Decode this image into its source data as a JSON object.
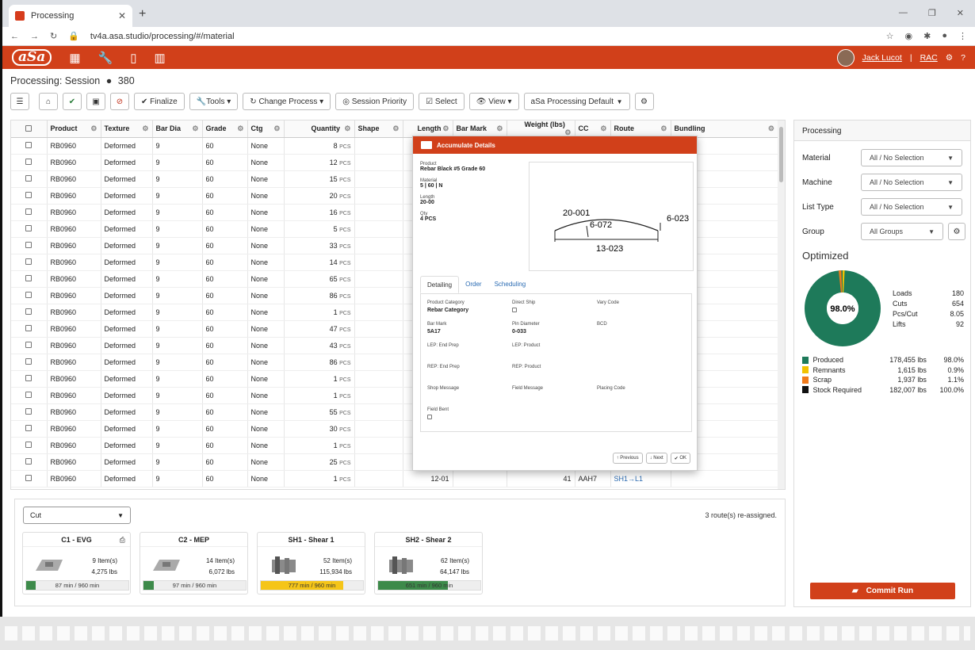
{
  "browser": {
    "tab_title": "Processing",
    "url": "tv4a.asa.studio/processing/#/material"
  },
  "app": {
    "logo": "aSa",
    "user": "Jack Lucot",
    "org": "RAC"
  },
  "page": {
    "title": "Processing: Session",
    "bullet": "●",
    "session": "380"
  },
  "toolbar": {
    "finalize": "Finalize",
    "tools": "Tools",
    "change_process": "Change Process",
    "session_priority": "Session Priority",
    "select": "Select",
    "view": "View",
    "profile": "aSa Processing Default"
  },
  "grid": {
    "columns": [
      "Product",
      "Texture",
      "Bar Dia",
      "Grade",
      "Ctg",
      "Quantity",
      "Shape",
      "Length",
      "Bar Mark",
      "Weight (lbs)",
      "CC",
      "Route",
      "Bundling"
    ],
    "unit": "PCS",
    "rows": [
      {
        "product": "RB0960",
        "texture": "Deformed",
        "dia": "9",
        "grade": "60",
        "ctg": "None",
        "qty": "8"
      },
      {
        "product": "RB0960",
        "texture": "Deformed",
        "dia": "9",
        "grade": "60",
        "ctg": "None",
        "qty": "12"
      },
      {
        "product": "RB0960",
        "texture": "Deformed",
        "dia": "9",
        "grade": "60",
        "ctg": "None",
        "qty": "15"
      },
      {
        "product": "RB0960",
        "texture": "Deformed",
        "dia": "9",
        "grade": "60",
        "ctg": "None",
        "qty": "20"
      },
      {
        "product": "RB0960",
        "texture": "Deformed",
        "dia": "9",
        "grade": "60",
        "ctg": "None",
        "qty": "16"
      },
      {
        "product": "RB0960",
        "texture": "Deformed",
        "dia": "9",
        "grade": "60",
        "ctg": "None",
        "qty": "5"
      },
      {
        "product": "RB0960",
        "texture": "Deformed",
        "dia": "9",
        "grade": "60",
        "ctg": "None",
        "qty": "33"
      },
      {
        "product": "RB0960",
        "texture": "Deformed",
        "dia": "9",
        "grade": "60",
        "ctg": "None",
        "qty": "14"
      },
      {
        "product": "RB0960",
        "texture": "Deformed",
        "dia": "9",
        "grade": "60",
        "ctg": "None",
        "qty": "65"
      },
      {
        "product": "RB0960",
        "texture": "Deformed",
        "dia": "9",
        "grade": "60",
        "ctg": "None",
        "qty": "86"
      },
      {
        "product": "RB0960",
        "texture": "Deformed",
        "dia": "9",
        "grade": "60",
        "ctg": "None",
        "qty": "1"
      },
      {
        "product": "RB0960",
        "texture": "Deformed",
        "dia": "9",
        "grade": "60",
        "ctg": "None",
        "qty": "47"
      },
      {
        "product": "RB0960",
        "texture": "Deformed",
        "dia": "9",
        "grade": "60",
        "ctg": "None",
        "qty": "43"
      },
      {
        "product": "RB0960",
        "texture": "Deformed",
        "dia": "9",
        "grade": "60",
        "ctg": "None",
        "qty": "86"
      },
      {
        "product": "RB0960",
        "texture": "Deformed",
        "dia": "9",
        "grade": "60",
        "ctg": "None",
        "qty": "1"
      },
      {
        "product": "RB0960",
        "texture": "Deformed",
        "dia": "9",
        "grade": "60",
        "ctg": "None",
        "qty": "1"
      },
      {
        "product": "RB0960",
        "texture": "Deformed",
        "dia": "9",
        "grade": "60",
        "ctg": "None",
        "qty": "55"
      },
      {
        "product": "RB0960",
        "texture": "Deformed",
        "dia": "9",
        "grade": "60",
        "ctg": "None",
        "qty": "30"
      },
      {
        "product": "RB0960",
        "texture": "Deformed",
        "dia": "9",
        "grade": "60",
        "ctg": "None",
        "qty": "1"
      },
      {
        "product": "RB0960",
        "texture": "Deformed",
        "dia": "9",
        "grade": "60",
        "ctg": "None",
        "qty": "25"
      },
      {
        "product": "RB0960",
        "texture": "Deformed",
        "dia": "9",
        "grade": "60",
        "ctg": "None",
        "qty": "1",
        "length": "12-01",
        "weight": "41",
        "cc": "AAH7",
        "route": "SH1→L1"
      }
    ]
  },
  "modal": {
    "title": "Accumulate Details",
    "product_label": "Product",
    "product": "Rebar Black #5 Grade 60",
    "material_label": "Material",
    "material": "5 | 60 | N",
    "length_label": "Length",
    "length": "20-00",
    "qty_label": "Qty",
    "qty": "4 PCS",
    "dims": {
      "a": "20-001",
      "b": "6-072",
      "c": "6-023",
      "d": "13-023"
    },
    "tabs": [
      "Detailing",
      "Order",
      "Scheduling"
    ],
    "fields": {
      "product_category": "Product Category",
      "product_category_val": "Rebar Category",
      "direct_ship": "Direct Ship",
      "vary_code": "Vary Code",
      "bar_mark": "Bar Mark",
      "bar_mark_val": "5A17",
      "pin_diameter": "Pin Diameter",
      "pin_diameter_val": "0-033",
      "bcd": "BCD",
      "lep_end": "LEP: End Prep",
      "lep_product": "LEP: Product",
      "rep_end": "REP: End Prep",
      "rep_product": "REP: Product",
      "shop_message": "Shop Message",
      "field_message": "Field Message",
      "placing_code": "Placing Code",
      "field_bent": "Field Bent"
    },
    "previous": "Previous",
    "next": "Next",
    "ok": "OK"
  },
  "panel": {
    "title": "Processing",
    "material": "Material",
    "machine": "Machine",
    "list_type": "List Type",
    "group": "Group",
    "no_sel": "All / No Selection",
    "all_groups": "All Groups",
    "optimized": "Optimized",
    "pct": "98.0%",
    "stats": [
      {
        "k": "Loads",
        "v": "180"
      },
      {
        "k": "Cuts",
        "v": "654"
      },
      {
        "k": "Pcs/Cut",
        "v": "8.05"
      },
      {
        "k": "Lifts",
        "v": "92"
      }
    ],
    "legend": [
      {
        "n": "Produced",
        "v": "178,455 lbs",
        "p": "98.0%",
        "c": "#1e7a5a"
      },
      {
        "n": "Remnants",
        "v": "1,615 lbs",
        "p": "0.9%",
        "c": "#f2c200"
      },
      {
        "n": "Scrap",
        "v": "1,937 lbs",
        "p": "1.1%",
        "c": "#f07a1a"
      },
      {
        "n": "Stock Required",
        "v": "182,007 lbs",
        "p": "100.0%",
        "c": "#111111"
      }
    ],
    "commit": "Commit Run"
  },
  "bottom": {
    "mode": "Cut",
    "reassigned": "3 route(s) re-assigned.",
    "machines": [
      {
        "name": "C1 - EVG",
        "items": "9 Item(s)",
        "lbs": "4,275 lbs",
        "time": "87 min / 960 min",
        "fill": 0.09,
        "color": "#3d8a4a"
      },
      {
        "name": "C2 - MEP",
        "items": "14 Item(s)",
        "lbs": "6,072 lbs",
        "time": "97 min / 960 min",
        "fill": 0.1,
        "color": "#3d8a4a"
      },
      {
        "name": "SH1 - Shear 1",
        "items": "52 Item(s)",
        "lbs": "115,934 lbs",
        "time": "777 min / 960 min",
        "fill": 0.81,
        "color": "#f5c518"
      },
      {
        "name": "SH2 - Shear 2",
        "items": "62 Item(s)",
        "lbs": "64,147 lbs",
        "time": "651 min / 960 min",
        "fill": 0.68,
        "color": "#3d8a4a"
      }
    ]
  }
}
